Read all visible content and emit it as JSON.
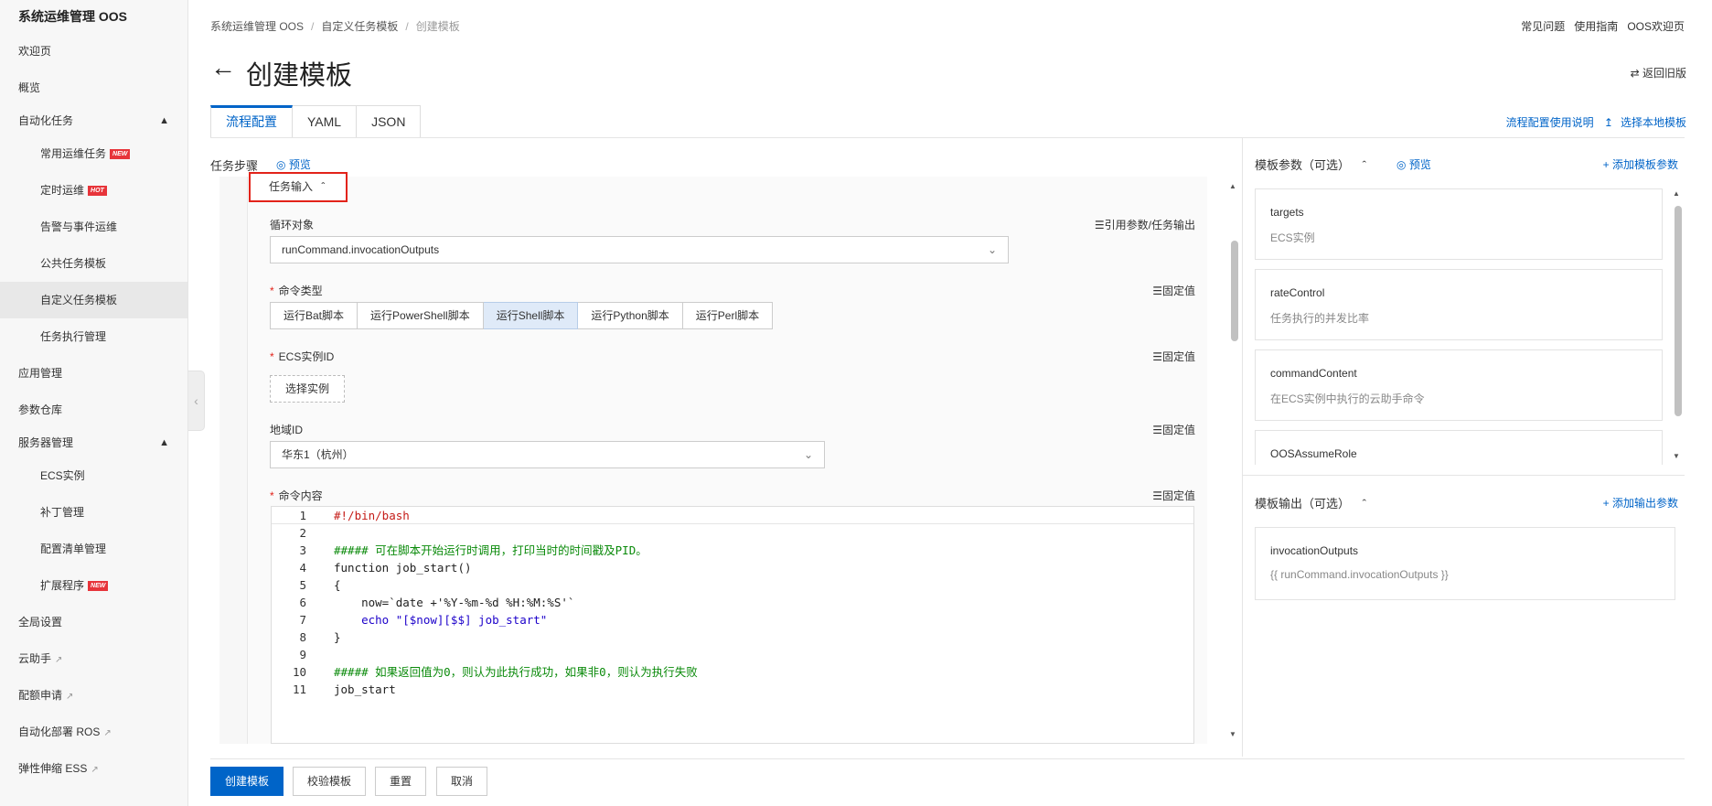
{
  "sidebar": {
    "title": "系统运维管理 OOS",
    "items": [
      {
        "label": "欢迎页"
      },
      {
        "label": "概览"
      },
      {
        "label": "自动化任务"
      },
      {
        "label": "常用运维任务",
        "badge": "NEW"
      },
      {
        "label": "定时运维",
        "badge": "HOT"
      },
      {
        "label": "告警与事件运维"
      },
      {
        "label": "公共任务模板"
      },
      {
        "label": "自定义任务模板"
      },
      {
        "label": "任务执行管理"
      },
      {
        "label": "应用管理"
      },
      {
        "label": "参数仓库"
      },
      {
        "label": "服务器管理"
      },
      {
        "label": "ECS实例"
      },
      {
        "label": "补丁管理"
      },
      {
        "label": "配置清单管理"
      },
      {
        "label": "扩展程序",
        "badge": "NEW"
      },
      {
        "label": "全局设置"
      },
      {
        "label": "云助手"
      },
      {
        "label": "配额申请"
      },
      {
        "label": "自动化部署 ROS"
      },
      {
        "label": "弹性伸缩 ESS"
      }
    ]
  },
  "breadcrumb": [
    "系统运维管理 OOS",
    "自定义任务模板",
    "创建模板"
  ],
  "top_links": [
    "常见问题",
    "使用指南",
    "OOS欢迎页"
  ],
  "page": {
    "title": "创建模板",
    "old_version": "返回旧版"
  },
  "tabs": [
    "流程配置",
    "YAML",
    "JSON"
  ],
  "tab_links": [
    "流程配置使用说明",
    "选择本地模板"
  ],
  "steps": {
    "label": "任务步骤",
    "preview": "预览"
  },
  "task_input": {
    "header": "任务输入",
    "loop_label": "循环对象",
    "loop_link": "引用参数/任务输出",
    "loop_value": "runCommand.invocationOutputs",
    "cmd_type_label": "命令类型",
    "fixed_value": "固定值",
    "cmd_types": [
      "运行Bat脚本",
      "运行PowerShell脚本",
      "运行Shell脚本",
      "运行Python脚本",
      "运行Perl脚本"
    ],
    "cmd_type_selected": "运行Shell脚本",
    "ecs_label": "ECS实例ID",
    "ecs_button": "选择实例",
    "region_label": "地域ID",
    "region_value": "华东1（杭州）",
    "content_label": "命令内容"
  },
  "code_lines": [
    {
      "n": "1",
      "text": "#!/bin/bash"
    },
    {
      "n": "2",
      "text": ""
    },
    {
      "n": "3",
      "text": "##### 可在脚本开始运行时调用，打印当时的时间戳及PID。"
    },
    {
      "n": "4",
      "text": "function job_start()"
    },
    {
      "n": "5",
      "text": "{"
    },
    {
      "n": "6",
      "text": "    now=`date +'%Y-%m-%d %H:%M:%S'`"
    },
    {
      "n": "7",
      "text": "    echo \"[$now][$$] job_start\""
    },
    {
      "n": "8",
      "text": "}"
    },
    {
      "n": "9",
      "text": ""
    },
    {
      "n": "10",
      "text": "##### 如果返回值为0，则认为此执行成功，如果非0，则认为执行失败"
    },
    {
      "n": "11",
      "text": "job_start"
    }
  ],
  "params": {
    "title": "模板参数（可选）",
    "preview": "预览",
    "add": "添加模板参数",
    "items": [
      {
        "name": "targets",
        "desc": "ECS实例"
      },
      {
        "name": "rateControl",
        "desc": "任务执行的并发比率"
      },
      {
        "name": "commandContent",
        "desc": "在ECS实例中执行的云助手命令"
      },
      {
        "name": "OOSAssumeRole",
        "desc": ""
      }
    ]
  },
  "outputs": {
    "title": "模板输出（可选）",
    "add": "添加输出参数",
    "items": [
      {
        "name": "invocationOutputs",
        "desc": "{{ runCommand.invocationOutputs }}"
      }
    ]
  },
  "footer": [
    "创建模板",
    "校验模板",
    "重置",
    "取消"
  ],
  "colors": {
    "primary": "#0064c8",
    "highlight": "#e2231a",
    "badge": "#e7343a"
  }
}
